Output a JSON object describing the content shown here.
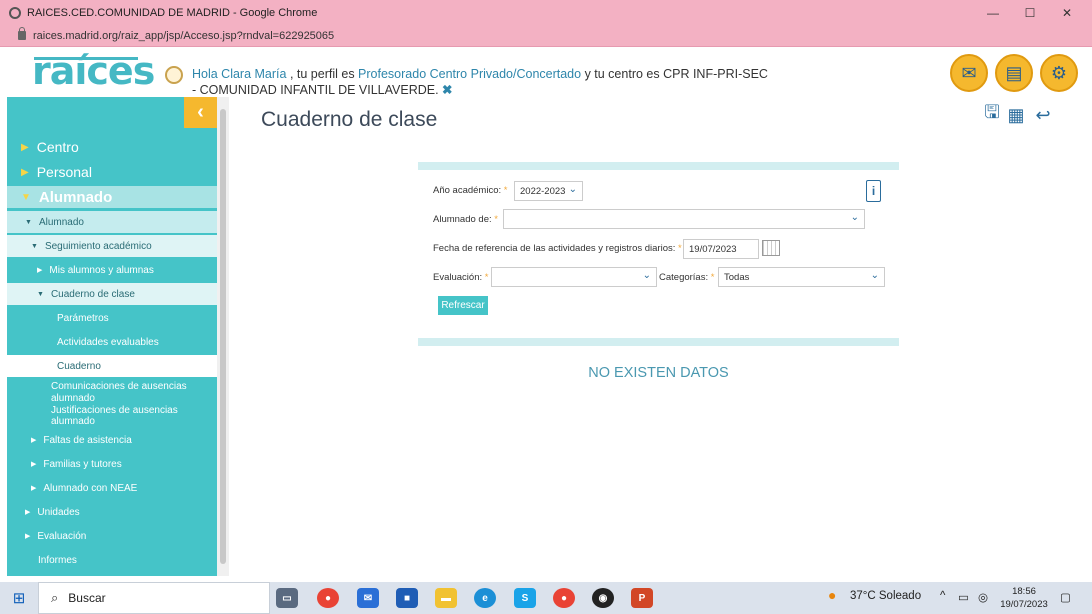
{
  "browser": {
    "window_title": "RAICES.CED.COMUNIDAD DE MADRID - Google Chrome",
    "url": "raices.madrid.org/raiz_app/jsp/Acceso.jsp?rndval=622925065",
    "controls": {
      "minimize": "—",
      "maximize": "☐",
      "close": "✕"
    }
  },
  "header": {
    "logo": "raíces",
    "greeting_prefix": "Hola Clara María",
    "greeting_mid1": " , tu perfil es ",
    "profile": "Profesorado Centro Privado/Concertado",
    "greeting_mid2": " y tu centro es CPR INF-PRI-SEC - COMUNIDAD INFANTIL DE VILLAVERDE. ",
    "close_mark": "✖",
    "buttons": [
      "mail-icon",
      "documents-icon",
      "settings-icon"
    ]
  },
  "sidebar": {
    "collapse": "‹",
    "top_items": [
      {
        "label": "Centro"
      },
      {
        "label": "Personal"
      },
      {
        "label": "Alumnado"
      }
    ],
    "alumnado": "Alumnado",
    "seguimiento": "Seguimiento académico",
    "mis_alumnos": "Mis alumnos y alumnas",
    "cuaderno_clase": "Cuaderno de clase",
    "parametros": "Parámetros",
    "actividades": "Actividades evaluables",
    "cuaderno": "Cuaderno",
    "comunicaciones": "Comunicaciones de ausencias alumnado",
    "justificaciones": "Justificaciones de ausencias alumnado",
    "faltas": "Faltas de asistencia",
    "familias": "Familias y tutores",
    "neae": "Alumnado con NEAE",
    "unidades": "Unidades",
    "evaluacion": "Evaluación",
    "informes": "Informes"
  },
  "main": {
    "title": "Cuaderno de clase",
    "form": {
      "ano_label": "Año académico:",
      "ano_value": "2022-2023",
      "alumnado_label": "Alumnado de:",
      "alumnado_value": "",
      "fecha_label": "Fecha de referencia de las actividades y registros diarios:",
      "fecha_value": "19/07/2023",
      "evaluacion_label": "Evaluación:",
      "evaluacion_value": "",
      "categorias_label": "Categorías:",
      "categorias_value": "Todas",
      "required_mark": "*",
      "refresh": "Refrescar"
    },
    "no_data": "NO EXISTEN DATOS"
  },
  "taskbar": {
    "search": "Buscar",
    "weather": "37°C  Soleado",
    "time": "18:56",
    "date": "19/07/2023"
  },
  "colors": {
    "sidebar": "#45c4c8",
    "accent": "#f5b82e",
    "chrome": "#f3b1c3"
  }
}
